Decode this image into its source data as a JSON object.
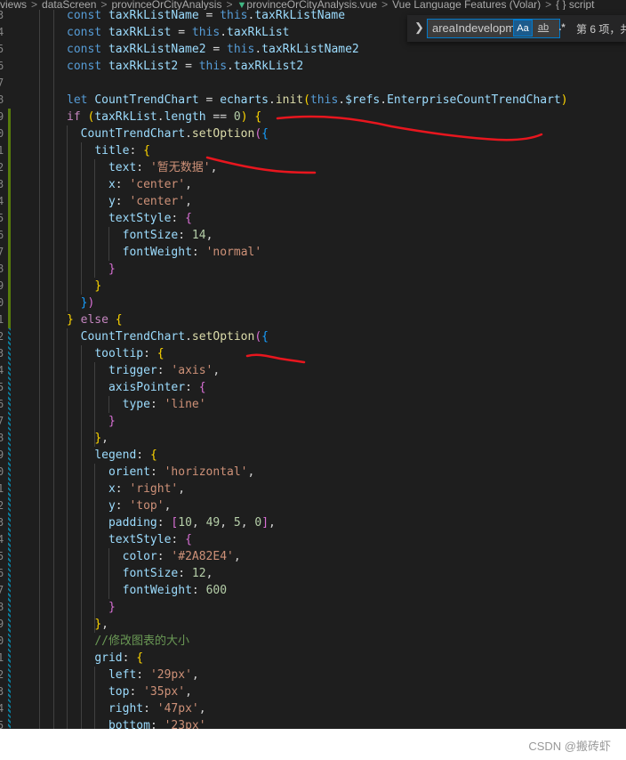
{
  "breadcrumb": {
    "items": [
      "views",
      "dataScreen",
      "provinceOrCityAnalysis",
      "provinceOrCityAnalysis.vue",
      "Vue Language Features (Volar)",
      "{ } script"
    ],
    "separator": ">"
  },
  "find_widget": {
    "query": "areaIndevelopm",
    "match_case_label": "Aa",
    "whole_word_label": "ab",
    "regex_label": ".*",
    "result_text": "第 6 项，共"
  },
  "line_numbers": [
    "3",
    "4",
    "5",
    "6",
    "7",
    "8",
    "9",
    "0",
    "1",
    "2",
    "3",
    "4",
    "5",
    "6",
    "7",
    "8",
    "9",
    "0",
    "1",
    "2",
    "3",
    "4",
    "5",
    "6",
    "7",
    "8",
    "9",
    "0",
    "1",
    "2",
    "3",
    "4",
    "5",
    "6",
    "7",
    "8",
    "9",
    "0",
    "1",
    "2",
    "3",
    "4",
    "5"
  ],
  "code_lines": [
    [
      [
        "k",
        "const "
      ],
      [
        "v",
        "taxRkListName"
      ],
      [
        "p",
        " = "
      ],
      [
        "k",
        "this"
      ],
      [
        "p",
        "."
      ],
      [
        "v",
        "taxRkListName"
      ]
    ],
    [
      [
        "k",
        "const "
      ],
      [
        "v",
        "taxRkList"
      ],
      [
        "p",
        " = "
      ],
      [
        "k",
        "this"
      ],
      [
        "p",
        "."
      ],
      [
        "v",
        "taxRkList"
      ]
    ],
    [
      [
        "k",
        "const "
      ],
      [
        "v",
        "taxRkListName2"
      ],
      [
        "p",
        " = "
      ],
      [
        "k",
        "this"
      ],
      [
        "p",
        "."
      ],
      [
        "v",
        "taxRkListName2"
      ]
    ],
    [
      [
        "k",
        "const "
      ],
      [
        "v",
        "taxRkList2"
      ],
      [
        "p",
        " = "
      ],
      [
        "k",
        "this"
      ],
      [
        "p",
        "."
      ],
      [
        "v",
        "taxRkList2"
      ]
    ],
    [],
    [
      [
        "k",
        "let "
      ],
      [
        "v",
        "CountTrendChart"
      ],
      [
        "p",
        " = "
      ],
      [
        "v",
        "echarts"
      ],
      [
        "p",
        "."
      ],
      [
        "fn",
        "init"
      ],
      [
        "br1",
        "("
      ],
      [
        "k",
        "this"
      ],
      [
        "p",
        "."
      ],
      [
        "v",
        "$refs"
      ],
      [
        "p",
        "."
      ],
      [
        "v",
        "EnterpriseCountTrendChart"
      ],
      [
        "br1",
        ")"
      ]
    ],
    [
      [
        "kw",
        "if "
      ],
      [
        "br1",
        "("
      ],
      [
        "v",
        "taxRkList"
      ],
      [
        "p",
        "."
      ],
      [
        "v",
        "length"
      ],
      [
        "p",
        " == "
      ],
      [
        "n",
        "0"
      ],
      [
        "br1",
        ")"
      ],
      [
        "p",
        " "
      ],
      [
        "br1",
        "{"
      ]
    ],
    [
      [
        "p",
        "  "
      ],
      [
        "v",
        "CountTrendChart"
      ],
      [
        "p",
        "."
      ],
      [
        "fn",
        "setOption"
      ],
      [
        "br2",
        "("
      ],
      [
        "br3",
        "{"
      ]
    ],
    [
      [
        "p",
        "    "
      ],
      [
        "v",
        "title"
      ],
      [
        "p",
        ": "
      ],
      [
        "br1",
        "{"
      ]
    ],
    [
      [
        "p",
        "      "
      ],
      [
        "v",
        "text"
      ],
      [
        "p",
        ": "
      ],
      [
        "s",
        "'暂无数据'"
      ],
      [
        "p",
        ","
      ]
    ],
    [
      [
        "p",
        "      "
      ],
      [
        "v",
        "x"
      ],
      [
        "p",
        ": "
      ],
      [
        "s",
        "'center'"
      ],
      [
        "p",
        ","
      ]
    ],
    [
      [
        "p",
        "      "
      ],
      [
        "v",
        "y"
      ],
      [
        "p",
        ": "
      ],
      [
        "s",
        "'center'"
      ],
      [
        "p",
        ","
      ]
    ],
    [
      [
        "p",
        "      "
      ],
      [
        "v",
        "textStyle"
      ],
      [
        "p",
        ": "
      ],
      [
        "br2",
        "{"
      ]
    ],
    [
      [
        "p",
        "        "
      ],
      [
        "v",
        "fontSize"
      ],
      [
        "p",
        ": "
      ],
      [
        "n",
        "14"
      ],
      [
        "p",
        ","
      ]
    ],
    [
      [
        "p",
        "        "
      ],
      [
        "v",
        "fontWeight"
      ],
      [
        "p",
        ": "
      ],
      [
        "s",
        "'normal'"
      ]
    ],
    [
      [
        "p",
        "      "
      ],
      [
        "br2",
        "}"
      ]
    ],
    [
      [
        "p",
        "    "
      ],
      [
        "br1",
        "}"
      ]
    ],
    [
      [
        "p",
        "  "
      ],
      [
        "br3",
        "}"
      ],
      [
        "br2",
        ")"
      ]
    ],
    [
      [
        "br1",
        "}"
      ],
      [
        "p",
        " "
      ],
      [
        "kw",
        "else "
      ],
      [
        "br1",
        "{"
      ]
    ],
    [
      [
        "p",
        "  "
      ],
      [
        "v",
        "CountTrendChart"
      ],
      [
        "p",
        "."
      ],
      [
        "fn",
        "setOption"
      ],
      [
        "br2",
        "("
      ],
      [
        "br3",
        "{"
      ]
    ],
    [
      [
        "p",
        "    "
      ],
      [
        "v",
        "tooltip"
      ],
      [
        "p",
        ": "
      ],
      [
        "br1",
        "{"
      ]
    ],
    [
      [
        "p",
        "      "
      ],
      [
        "v",
        "trigger"
      ],
      [
        "p",
        ": "
      ],
      [
        "s",
        "'axis'"
      ],
      [
        "p",
        ","
      ]
    ],
    [
      [
        "p",
        "      "
      ],
      [
        "v",
        "axisPointer"
      ],
      [
        "p",
        ": "
      ],
      [
        "br2",
        "{"
      ]
    ],
    [
      [
        "p",
        "        "
      ],
      [
        "v",
        "type"
      ],
      [
        "p",
        ": "
      ],
      [
        "s",
        "'line'"
      ]
    ],
    [
      [
        "p",
        "      "
      ],
      [
        "br2",
        "}"
      ]
    ],
    [
      [
        "p",
        "    "
      ],
      [
        "br1",
        "}"
      ],
      [
        "p",
        ","
      ]
    ],
    [
      [
        "p",
        "    "
      ],
      [
        "v",
        "legend"
      ],
      [
        "p",
        ": "
      ],
      [
        "br1",
        "{"
      ]
    ],
    [
      [
        "p",
        "      "
      ],
      [
        "v",
        "orient"
      ],
      [
        "p",
        ": "
      ],
      [
        "s",
        "'horizontal'"
      ],
      [
        "p",
        ","
      ]
    ],
    [
      [
        "p",
        "      "
      ],
      [
        "v",
        "x"
      ],
      [
        "p",
        ": "
      ],
      [
        "s",
        "'right'"
      ],
      [
        "p",
        ","
      ]
    ],
    [
      [
        "p",
        "      "
      ],
      [
        "v",
        "y"
      ],
      [
        "p",
        ": "
      ],
      [
        "s",
        "'top'"
      ],
      [
        "p",
        ","
      ]
    ],
    [
      [
        "p",
        "      "
      ],
      [
        "v",
        "padding"
      ],
      [
        "p",
        ": "
      ],
      [
        "br2",
        "["
      ],
      [
        "n",
        "10"
      ],
      [
        "p",
        ", "
      ],
      [
        "n",
        "49"
      ],
      [
        "p",
        ", "
      ],
      [
        "n",
        "5"
      ],
      [
        "p",
        ", "
      ],
      [
        "n",
        "0"
      ],
      [
        "br2",
        "]"
      ],
      [
        "p",
        ","
      ]
    ],
    [
      [
        "p",
        "      "
      ],
      [
        "v",
        "textStyle"
      ],
      [
        "p",
        ": "
      ],
      [
        "br2",
        "{"
      ]
    ],
    [
      [
        "p",
        "        "
      ],
      [
        "v",
        "color"
      ],
      [
        "p",
        ": "
      ],
      [
        "s",
        "'#2A82E4'"
      ],
      [
        "p",
        ","
      ]
    ],
    [
      [
        "p",
        "        "
      ],
      [
        "v",
        "fontSize"
      ],
      [
        "p",
        ": "
      ],
      [
        "n",
        "12"
      ],
      [
        "p",
        ","
      ]
    ],
    [
      [
        "p",
        "        "
      ],
      [
        "v",
        "fontWeight"
      ],
      [
        "p",
        ": "
      ],
      [
        "n",
        "600"
      ]
    ],
    [
      [
        "p",
        "      "
      ],
      [
        "br2",
        "}"
      ]
    ],
    [
      [
        "p",
        "    "
      ],
      [
        "br1",
        "}"
      ],
      [
        "p",
        ","
      ]
    ],
    [
      [
        "p",
        "    "
      ],
      [
        "c",
        "//修改图表的大小"
      ]
    ],
    [
      [
        "p",
        "    "
      ],
      [
        "v",
        "grid"
      ],
      [
        "p",
        ": "
      ],
      [
        "br1",
        "{"
      ]
    ],
    [
      [
        "p",
        "      "
      ],
      [
        "v",
        "left"
      ],
      [
        "p",
        ": "
      ],
      [
        "s",
        "'29px'"
      ],
      [
        "p",
        ","
      ]
    ],
    [
      [
        "p",
        "      "
      ],
      [
        "v",
        "top"
      ],
      [
        "p",
        ": "
      ],
      [
        "s",
        "'35px'"
      ],
      [
        "p",
        ","
      ]
    ],
    [
      [
        "p",
        "      "
      ],
      [
        "v",
        "right"
      ],
      [
        "p",
        ": "
      ],
      [
        "s",
        "'47px'"
      ],
      [
        "p",
        ","
      ]
    ],
    [
      [
        "p",
        "      "
      ],
      [
        "v",
        "bottom"
      ],
      [
        "p",
        ": "
      ],
      [
        "s",
        "'23px'"
      ]
    ]
  ],
  "colors": {
    "background": "#1e1e1e",
    "annotation_red": "#e8161e",
    "find_border": "#007acc"
  },
  "watermark": "CSDN @搬砖虾"
}
